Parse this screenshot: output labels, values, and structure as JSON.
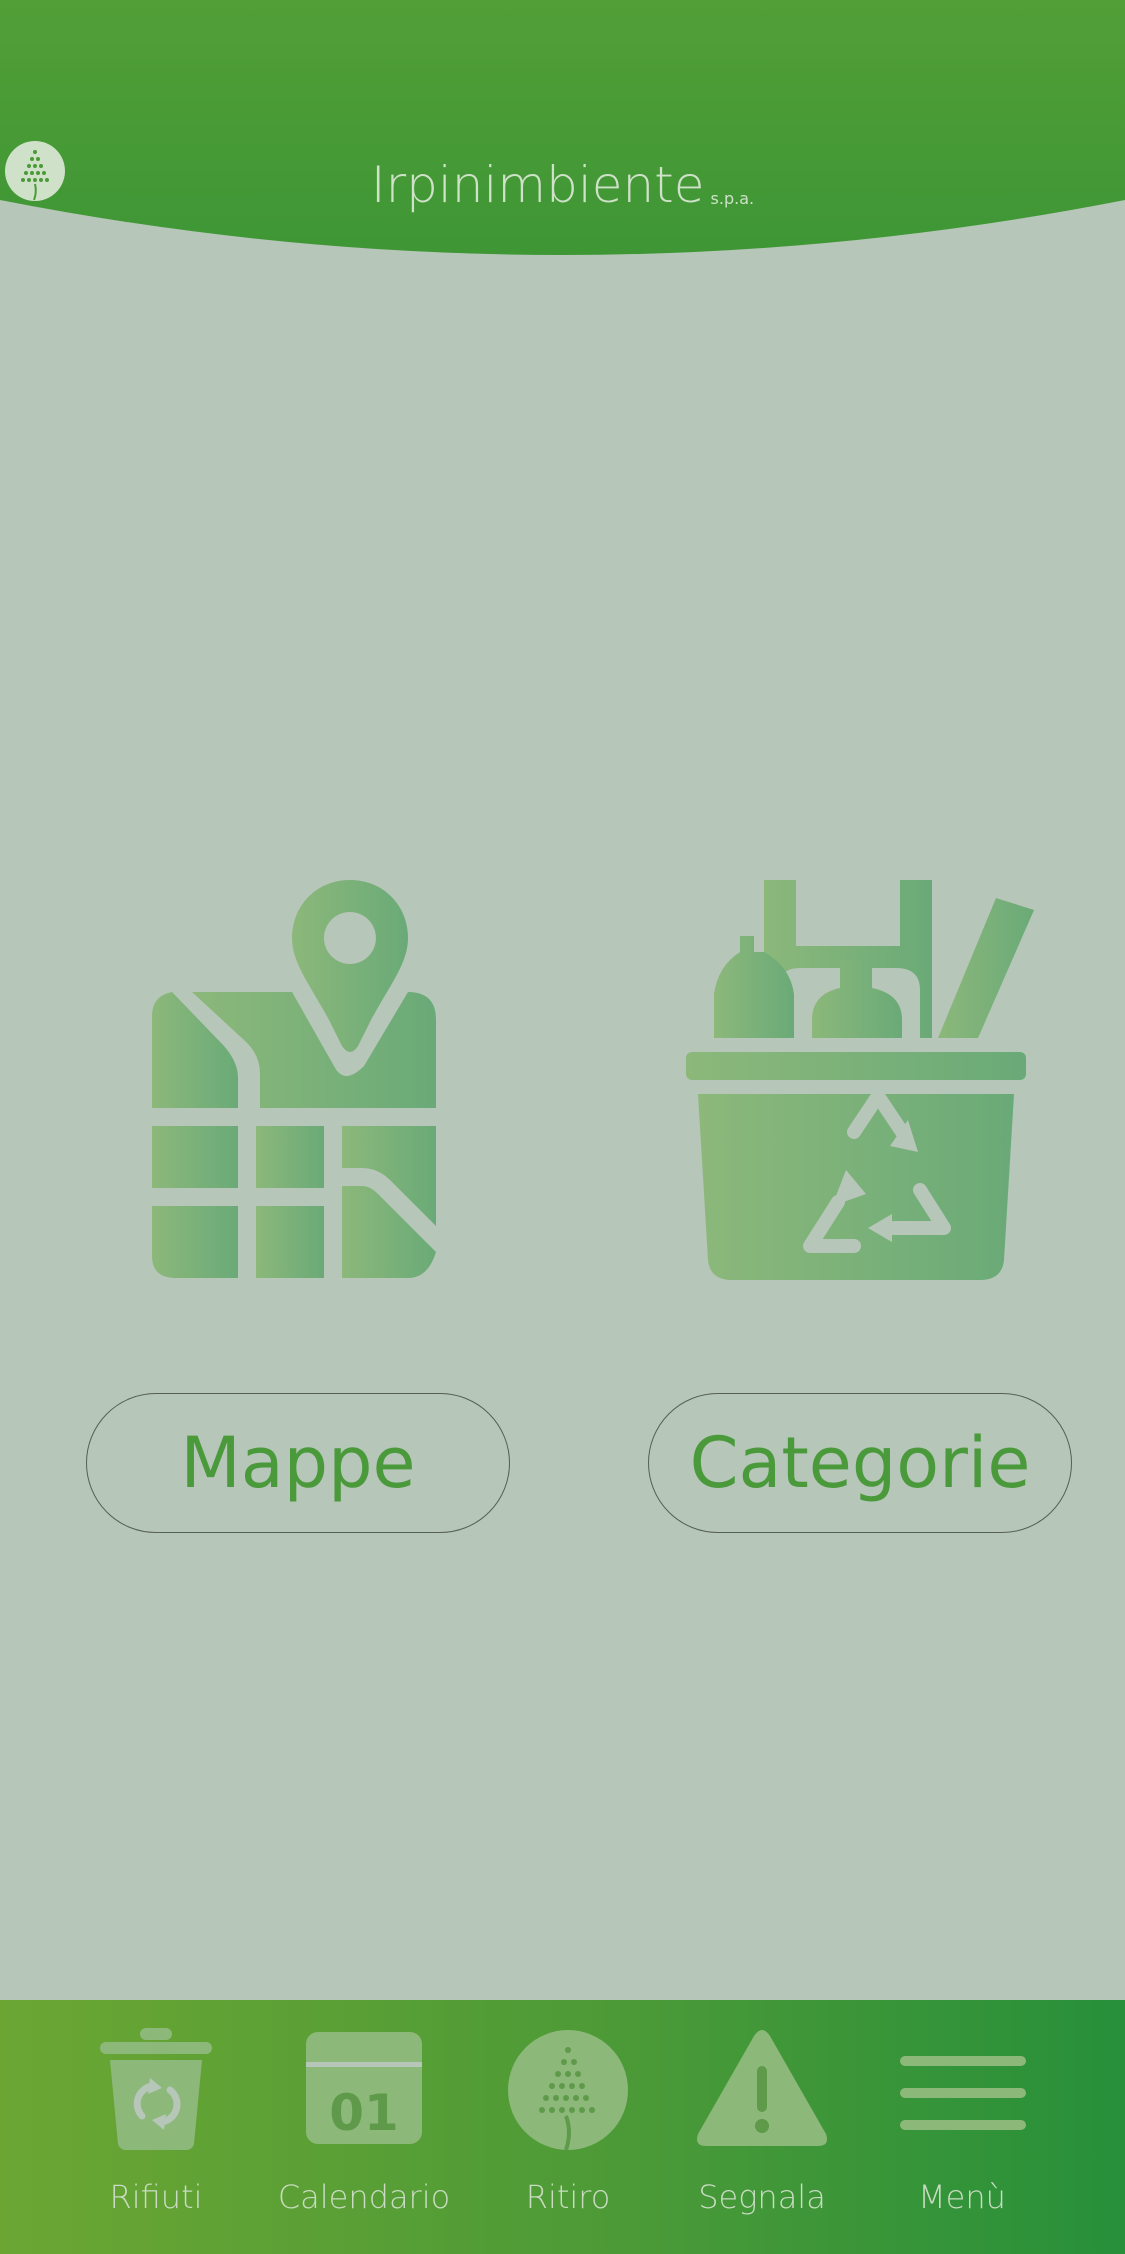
{
  "header": {
    "logo_left": "Irpini",
    "logo_right": "mbiente",
    "logo_suffix": "s.p.a."
  },
  "features": [
    {
      "label": "Mappe",
      "icon": "map-pin-icon"
    },
    {
      "label": "Categorie",
      "icon": "recycling-basket-icon"
    }
  ],
  "nav": [
    {
      "label": "Rifiuti",
      "icon": "recycle-bin-icon"
    },
    {
      "label": "Calendario",
      "icon": "calendar-icon",
      "day": "01"
    },
    {
      "label": "Ritiro",
      "icon": "pickup-drop-icon"
    },
    {
      "label": "Segnala",
      "icon": "warning-icon"
    },
    {
      "label": "Menù",
      "icon": "hamburger-menu-icon"
    }
  ],
  "colors": {
    "background": "#b6c6b8",
    "header_green": "#4a9a37",
    "accent_text": "#4a9a3c",
    "nav_label": "#c9dcc2"
  }
}
